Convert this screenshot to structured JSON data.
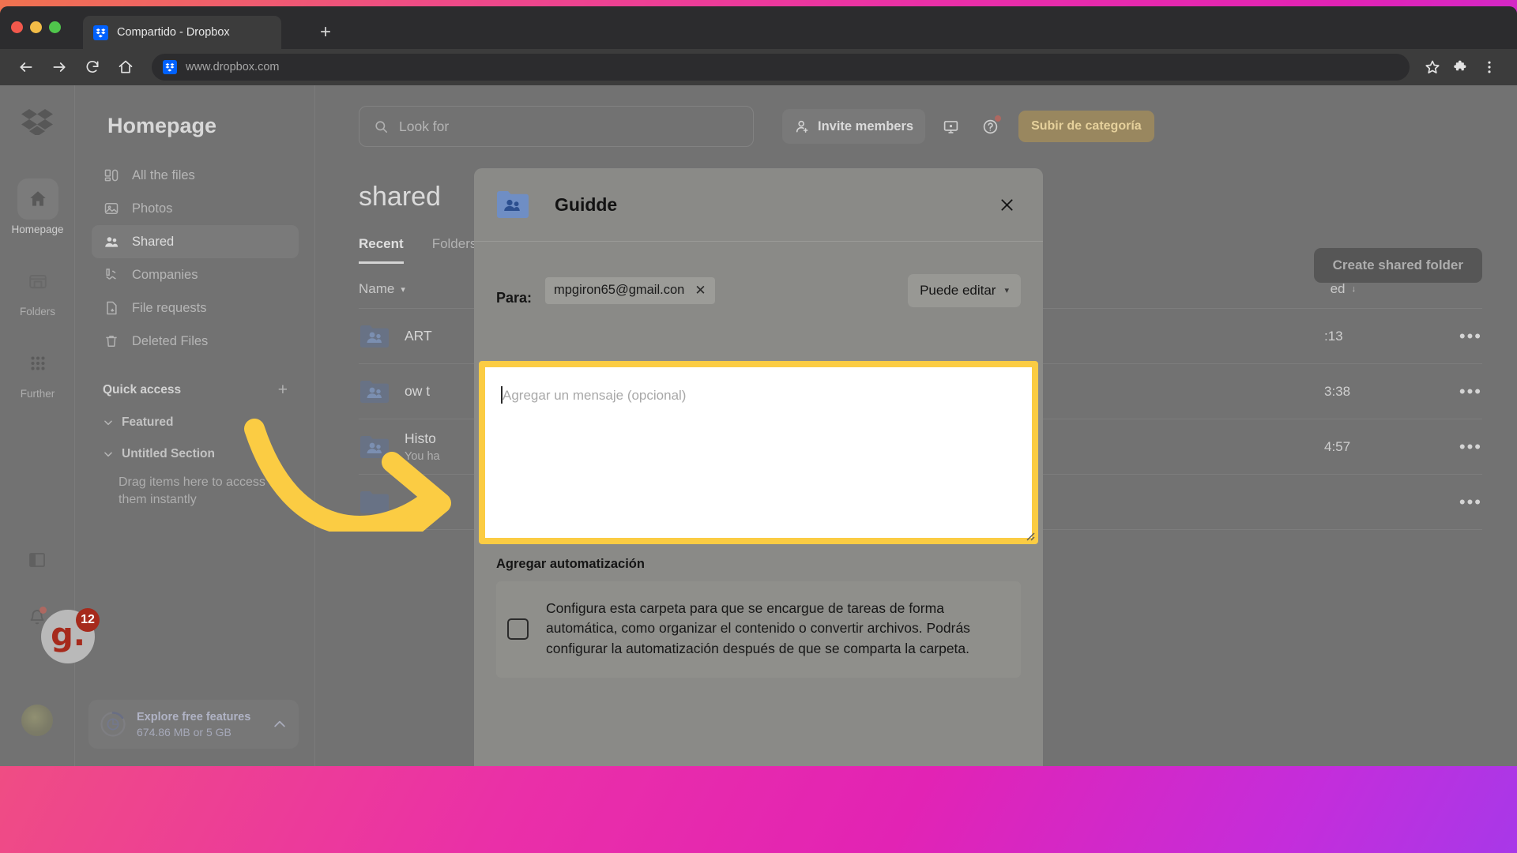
{
  "browser": {
    "tab_title": "Compartido - Dropbox",
    "new_tab_label": "+",
    "url": "www.dropbox.com",
    "back_icon": "back-arrow-icon",
    "forward_icon": "forward-arrow-icon",
    "reload_icon": "reload-icon",
    "home_icon": "home-icon",
    "bookmark_icon": "star-icon",
    "extensions_icon": "puzzle-icon",
    "menu_icon": "three-dot-menu-icon"
  },
  "rail": {
    "logo": "dropbox-logo-icon",
    "items": [
      {
        "label": "Homepage",
        "icon": "home-icon",
        "active": true
      },
      {
        "label": "Folders",
        "icon": "folder-icon",
        "active": false
      },
      {
        "label": "Further",
        "icon": "grid-dots-icon",
        "active": false
      }
    ],
    "panel_icon": "sidebar-toggle-icon",
    "bell_icon": "bell-icon",
    "avatar": "user-avatar"
  },
  "guidde": {
    "logo_text": "g.",
    "count": "12"
  },
  "sidebar": {
    "title": "Homepage",
    "items": [
      {
        "label": "All the files",
        "icon": "all-files-icon",
        "active": false
      },
      {
        "label": "Photos",
        "icon": "photos-icon",
        "active": false
      },
      {
        "label": "Shared",
        "icon": "shared-people-icon",
        "active": true
      },
      {
        "label": "Companies",
        "icon": "companies-icon",
        "active": false
      },
      {
        "label": "File requests",
        "icon": "file-request-icon",
        "active": false
      },
      {
        "label": "Deleted Files",
        "icon": "trash-icon",
        "active": false
      }
    ],
    "quick_access": {
      "title": "Quick access",
      "add_label": "+"
    },
    "sections": [
      {
        "label": "Featured"
      },
      {
        "label": "Untitled Section"
      }
    ],
    "drag_hint": "Drag items here to access them instantly",
    "storage": {
      "title": "Explore free features",
      "usage": "674.86 MB or 5 GB",
      "ring_icon": "storage-pie-icon",
      "caret_icon": "chevron-up-icon"
    }
  },
  "topbar": {
    "search_placeholder": "Look for",
    "search_icon": "search-icon",
    "invite_label": "Invite members",
    "invite_icon": "add-person-icon",
    "desktop_icon": "desktop-icon",
    "help_icon": "help-circle-icon",
    "upgrade_label": "Subir de categoría",
    "create_folder_label": "Create shared folder"
  },
  "page": {
    "title": "shared",
    "tabs": [
      {
        "label": "Recent",
        "active": true
      },
      {
        "label": "Folders",
        "active": false
      }
    ],
    "columns": {
      "name": "Name",
      "shared": "ed",
      "name_caret": "▾",
      "shared_caret": "↓"
    },
    "rows": [
      {
        "name": "ART",
        "sub": "",
        "time": ":13",
        "icon": "shared-folder-icon",
        "more": "•••"
      },
      {
        "name": "ow t",
        "sub": "",
        "time": "3:38",
        "icon": "shared-folder-icon",
        "more": "•••"
      },
      {
        "name": "Histo",
        "sub": "You ha",
        "time": "4:57",
        "icon": "shared-folder-icon",
        "more": "•••"
      },
      {
        "name": "",
        "sub": "",
        "time": "",
        "icon": "folder-icon",
        "more": "•••"
      }
    ]
  },
  "modal": {
    "folder_icon": "shared-folder-icon",
    "title": "Guidde",
    "close_icon": "close-icon",
    "to_label": "Para:",
    "recipient": "mpgiron65@gmail.con",
    "recipient_remove_icon": "remove-chip-icon",
    "permission": "Puede editar",
    "permission_caret": "▾",
    "message_placeholder": "Agregar un mensaje (opcional)",
    "message_value": "",
    "resize_icon": "resize-handle-icon",
    "automation_title": "Agregar automatización",
    "automation_text": "Configura esta carpeta para que se encargue de tareas de forma automática, como organizar el contenido o convertir archivos. Podrás configurar la automatización después de que se comparta la carpeta.",
    "automation_checked": false
  },
  "annotation": {
    "arrow_color": "#fbcc43",
    "highlight_color": "#fbcc43"
  }
}
